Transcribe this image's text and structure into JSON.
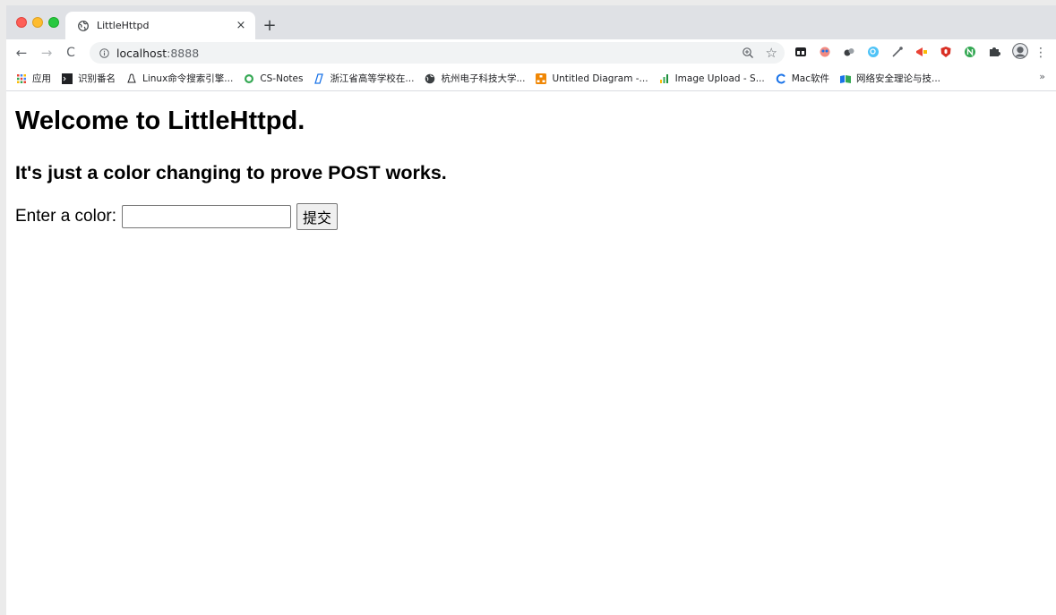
{
  "browser": {
    "tab": {
      "title": "LittleHttpd",
      "close": "×"
    },
    "new_tab": "+",
    "nav": {
      "back": "←",
      "forward": "→",
      "reload": "C"
    },
    "omnibox": {
      "host": "localhost",
      "port": ":8888",
      "star": "☆"
    },
    "menu": "⋮",
    "bookmarks": [
      {
        "label": "应用",
        "icon": "apps-grid-icon",
        "color": "#4285f4"
      },
      {
        "label": "识别番名",
        "icon": "terminal-icon",
        "color": "#202124"
      },
      {
        "label": "Linux命令搜索引擎...",
        "icon": "tux-icon",
        "color": "#202124"
      },
      {
        "label": "CS-Notes",
        "icon": "circle-icon",
        "color": "#34a853"
      },
      {
        "label": "浙江省高等学校在...",
        "icon": "zj-logo-icon",
        "color": "#1a73e8"
      },
      {
        "label": "杭州电子科技大学...",
        "icon": "globe-icon",
        "color": "#3c4043"
      },
      {
        "label": "Untitled Diagram -...",
        "icon": "drawio-icon",
        "color": "#f08705"
      },
      {
        "label": "Image Upload - S...",
        "icon": "bar-chart-icon",
        "color": "#1e8e3e"
      },
      {
        "label": "Mac软件",
        "icon": "c-logo-icon",
        "color": "#1a73e8"
      },
      {
        "label": "网络安全理论与技...",
        "icon": "folder-flag-icon",
        "color": "#1a73e8"
      }
    ],
    "bookmarks_more": "»",
    "extensions": [
      {
        "icon": "ext-folder-icon",
        "color": "#202124"
      },
      {
        "icon": "ext-ghost-icon",
        "color": "#ea4335"
      },
      {
        "icon": "ext-balls-icon",
        "color": "#5f6368"
      },
      {
        "icon": "ext-search-icon",
        "color": "#1a73e8"
      },
      {
        "icon": "ext-pipette-icon",
        "color": "#5f6368"
      },
      {
        "icon": "ext-megaphone-icon",
        "color": "#ea4335"
      },
      {
        "icon": "ext-ublock-icon",
        "color": "#ea4335"
      },
      {
        "icon": "ext-n-icon",
        "color": "#34a853"
      },
      {
        "icon": "ext-puzzle-icon",
        "color": "#5f6368"
      },
      {
        "icon": "ext-avatar-icon",
        "color": "#5f6368"
      }
    ]
  },
  "page": {
    "heading": "Welcome to LittleHttpd.",
    "subheading": "It's just a color changing to prove POST works.",
    "form": {
      "label": "Enter a color:",
      "input_value": "",
      "submit_label": "提交"
    }
  }
}
